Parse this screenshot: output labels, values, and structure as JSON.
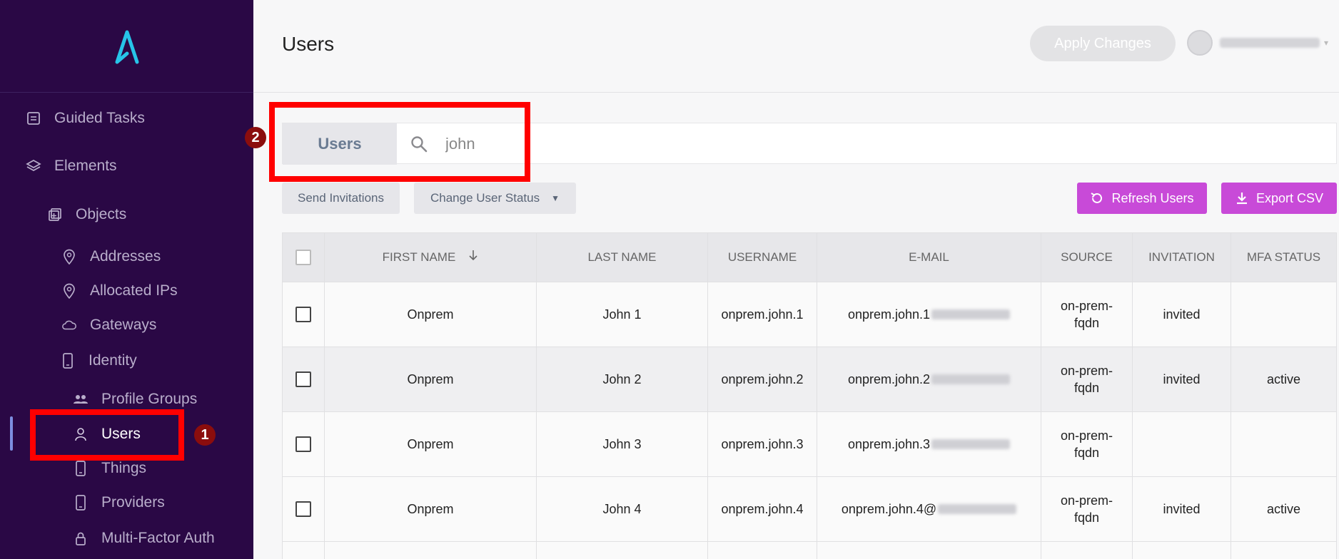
{
  "sidebar": {
    "logo": "A",
    "items": [
      {
        "label": "Guided Tasks",
        "icon": "list-icon"
      },
      {
        "label": "Elements",
        "icon": "layers-icon"
      },
      {
        "label": "Objects",
        "icon": "objects-icon"
      },
      {
        "label": "Addresses",
        "icon": "pin-icon"
      },
      {
        "label": "Allocated IPs",
        "icon": "pin-icon"
      },
      {
        "label": "Gateways",
        "icon": "cloud-icon"
      },
      {
        "label": "Identity",
        "icon": "phone-icon"
      },
      {
        "label": "Profile Groups",
        "icon": "group-icon"
      },
      {
        "label": "Users",
        "icon": "user-icon"
      },
      {
        "label": "Things",
        "icon": "device-icon"
      },
      {
        "label": "Providers",
        "icon": "device-icon"
      },
      {
        "label": "Multi-Factor Auth",
        "icon": "lock-icon"
      }
    ]
  },
  "annotations": {
    "badge1": "1",
    "badge2": "2"
  },
  "header": {
    "title": "Users",
    "apply_label": "Apply Changes"
  },
  "search": {
    "scope": "Users",
    "value": "john"
  },
  "actions": {
    "send_invitations": "Send Invitations",
    "change_status": "Change User Status",
    "refresh": "Refresh Users",
    "export": "Export CSV"
  },
  "table": {
    "columns": [
      "FIRST NAME",
      "LAST NAME",
      "USERNAME",
      "E-MAIL",
      "SOURCE",
      "INVITATION",
      "MFA STATUS"
    ],
    "rows": [
      {
        "first": "Onprem",
        "last": "John 1",
        "username": "onprem.john.1",
        "email": "onprem.john.1",
        "source": "on-prem-fqdn",
        "invitation": "invited",
        "mfa": ""
      },
      {
        "first": "Onprem",
        "last": "John 2",
        "username": "onprem.john.2",
        "email": "onprem.john.2",
        "source": "on-prem-fqdn",
        "invitation": "invited",
        "mfa": "active"
      },
      {
        "first": "Onprem",
        "last": "John 3",
        "username": "onprem.john.3",
        "email": "onprem.john.3",
        "source": "on-prem-fqdn",
        "invitation": "",
        "mfa": ""
      },
      {
        "first": "Onprem",
        "last": "John 4",
        "username": "onprem.john.4",
        "email": "onprem.john.4@",
        "source": "on-prem-fqdn",
        "invitation": "invited",
        "mfa": "active"
      }
    ]
  },
  "colors": {
    "sidebar_bg": "#2a0845",
    "accent_purple": "#c84ad8",
    "logo": "#27c4e8",
    "highlight": "#ff0000"
  }
}
